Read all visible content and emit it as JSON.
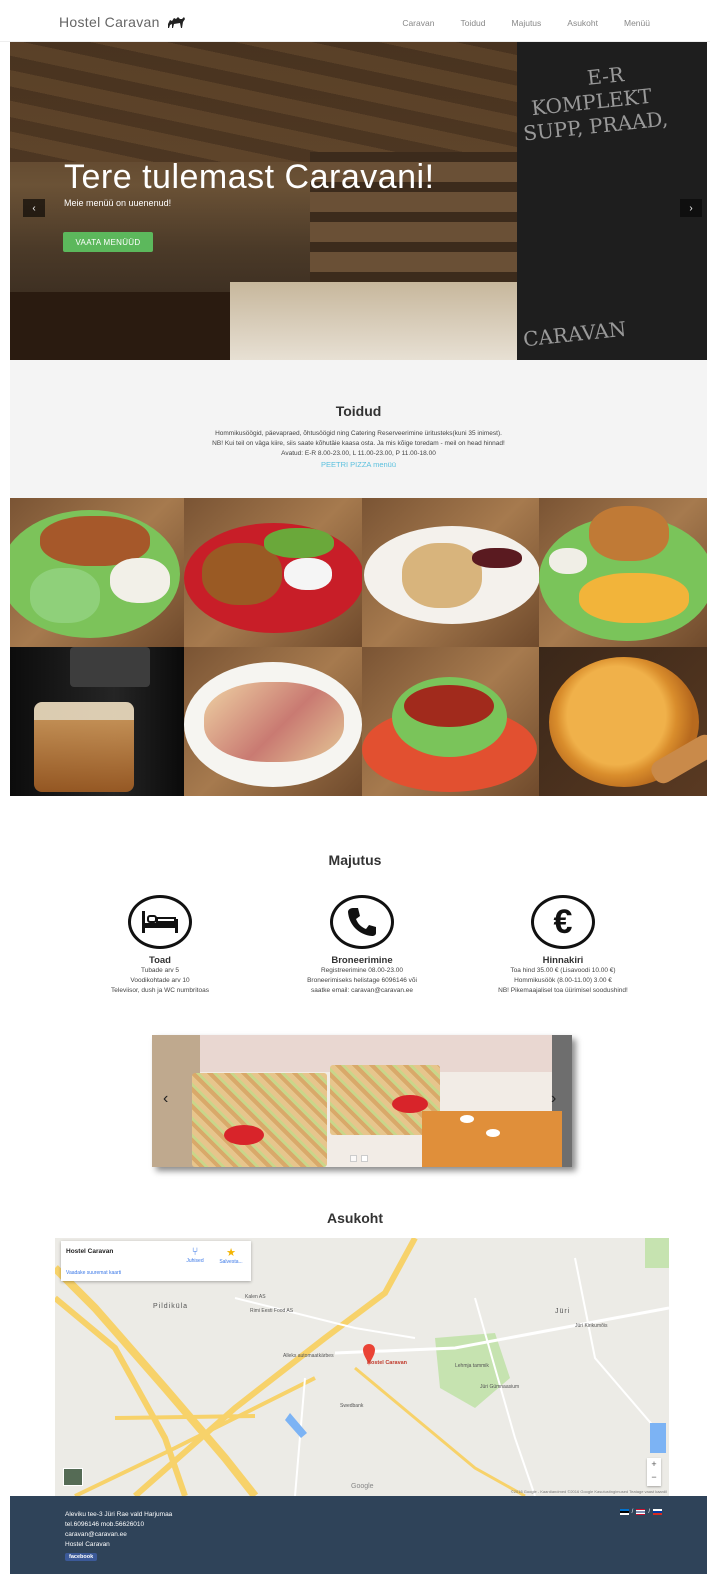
{
  "nav": {
    "brand": "Hostel Caravan",
    "links": [
      "Caravan",
      "Toidud",
      "Majutus",
      "Asukoht",
      "Menüü"
    ]
  },
  "hero": {
    "title": "Tere tulemast Caravani!",
    "subtitle": "Meie menüü on uuenenud!",
    "button": "VAATA MENÜÜD",
    "prev": "‹",
    "next": "›",
    "board_lines": [
      "E-R",
      "KOMPLEKT",
      "SUPP, PRAAD,",
      "CARAVAN"
    ]
  },
  "toidud": {
    "title": "Toidud",
    "line1": "Hommikusöögid, päevapraed, õhtusöögid ning Catering Reserveerimine üritusteks(kuni 35 inimest).",
    "line2": "NB! Kui teil on väga kiire, siis saate kõhutäie kaasa osta. Ja mis kõige toredam - meil on head hinnad!",
    "line3": "Avatud: E-R 8.00-23.00, L 11.00-23.00, P 11.00-18.00",
    "pizza_link": "PEETRI PIZZA menüü"
  },
  "majutus": {
    "title": "Majutus",
    "features": [
      {
        "title": "Toad",
        "lines": [
          "Tubade arv 5",
          "Voodikohtade arv 10",
          "Televiisor, dush ja WC numbritoas"
        ]
      },
      {
        "title": "Broneerimine",
        "lines": [
          "Registreerimine 08.00-23.00",
          "Broneerimiseks helistage 6096146 või",
          "saatke email: caravan@caravan.ee"
        ]
      },
      {
        "title": "Hinnakiri",
        "lines": [
          "Toa hind 35.00 € (Lisavoodi 10.00 €)",
          "Hommikusöök (8.00-11.00) 3.00 €",
          "NB! Pikemaajalisel toa üürimisel soodushind!"
        ]
      }
    ],
    "slider_prev": "‹",
    "slider_next": "›"
  },
  "asukoht": {
    "title": "Asukoht",
    "card_name": "Hostel Caravan",
    "card_larger": "Vaadake suuremat kaarti",
    "card_directions": "Juhised",
    "card_save": "Salvesta...",
    "pin_label": "Hostel Caravan",
    "labels": {
      "pildikula": "Pildiküla",
      "kalen": "Kalen AS",
      "rimi": "Rimi Eesti Food AS",
      "alleks": "Alleks automaatkärbes",
      "juri": "Jüri",
      "lehmja": "Lehmja tammik",
      "gumnaasium": "Jüri Gümnaasium",
      "swedbank": "Swedbank",
      "kirik": "Jüri Kirikumõis"
    },
    "google": "Google",
    "attribution": "©2016 Google - Kaardiandmed ©2016 Google   Kasutustingimused   Teatage vaast kaardil",
    "zoom_in": "+",
    "zoom_out": "−"
  },
  "footer": {
    "address": "Aleviku tee-3 Jüri Rae vald Harjumaa",
    "phone": "tel.6096146 mob.56626010",
    "email": "caravan@caravan.ee",
    "name": "Hostel Caravan",
    "facebook": "facebook",
    "flag_sep": "/"
  },
  "colors": {
    "accent_green": "#5cb85c",
    "link_blue": "#5bc0de",
    "footer_bg": "#2f4359"
  }
}
